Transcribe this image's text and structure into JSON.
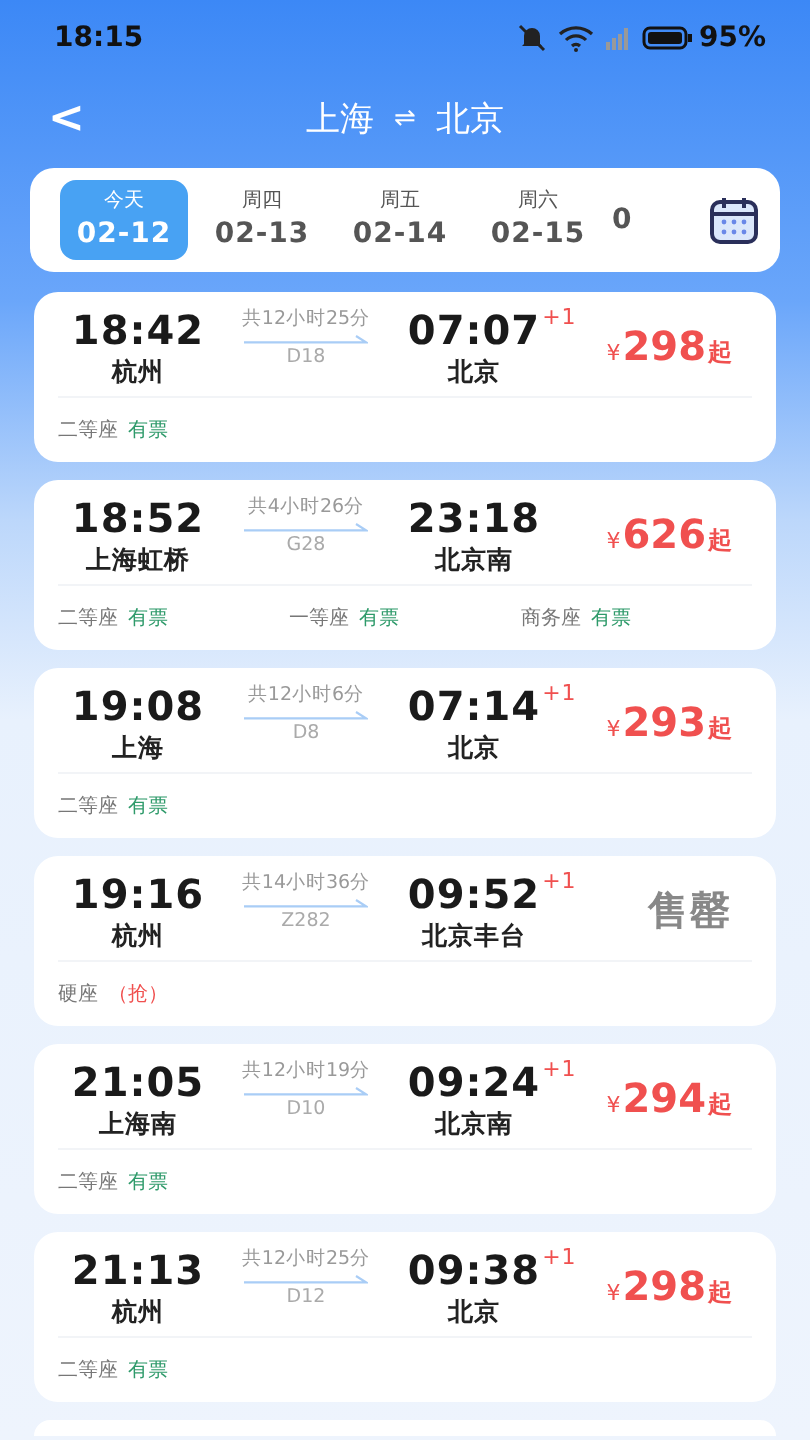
{
  "status_bar": {
    "time": "18:15",
    "battery": "95%"
  },
  "header": {
    "back": "<",
    "from": "上海",
    "swap": "⇌",
    "to": "北京"
  },
  "dates": [
    {
      "weekday": "今天",
      "date": "02-12",
      "selected": true
    },
    {
      "weekday": "周四",
      "date": "02-13",
      "selected": false
    },
    {
      "weekday": "周五",
      "date": "02-14",
      "selected": false
    },
    {
      "weekday": "周六",
      "date": "02-15",
      "selected": false
    },
    {
      "date": "0",
      "selected": false
    }
  ],
  "trains": [
    {
      "depart": "18:42",
      "from": "杭州",
      "duration": "共12小时25分",
      "code": "D18",
      "arrive": "07:07",
      "next_day": "+1",
      "to": "北京",
      "price": {
        "kind": "price",
        "currency": "¥",
        "amount": "298",
        "suffix": "起"
      },
      "seats": [
        {
          "class": "二等座",
          "status": "有票",
          "kind": "available"
        }
      ]
    },
    {
      "depart": "18:52",
      "from": "上海虹桥",
      "duration": "共4小时26分",
      "code": "G28",
      "arrive": "23:18",
      "to": "北京南",
      "price": {
        "kind": "price",
        "currency": "¥",
        "amount": "626",
        "suffix": "起"
      },
      "seats": [
        {
          "class": "二等座",
          "status": "有票",
          "kind": "available"
        },
        {
          "class": "一等座",
          "status": "有票",
          "kind": "available"
        },
        {
          "class": "商务座",
          "status": "有票",
          "kind": "available"
        }
      ]
    },
    {
      "depart": "19:08",
      "from": "上海",
      "duration": "共12小时6分",
      "code": "D8",
      "arrive": "07:14",
      "next_day": "+1",
      "to": "北京",
      "price": {
        "kind": "price",
        "currency": "¥",
        "amount": "293",
        "suffix": "起"
      },
      "seats": [
        {
          "class": "二等座",
          "status": "有票",
          "kind": "available"
        }
      ]
    },
    {
      "depart": "19:16",
      "from": "杭州",
      "duration": "共14小时36分",
      "code": "Z282",
      "arrive": "09:52",
      "next_day": "+1",
      "to": "北京丰台",
      "price": {
        "kind": "soldout",
        "text": "售罄"
      },
      "seats": [
        {
          "class": "硬座",
          "status": "（抢）",
          "kind": "grab"
        }
      ]
    },
    {
      "depart": "21:05",
      "from": "上海南",
      "duration": "共12小时19分",
      "code": "D10",
      "arrive": "09:24",
      "next_day": "+1",
      "to": "北京南",
      "price": {
        "kind": "price",
        "currency": "¥",
        "amount": "294",
        "suffix": "起"
      },
      "seats": [
        {
          "class": "二等座",
          "status": "有票",
          "kind": "available"
        }
      ]
    },
    {
      "depart": "21:13",
      "from": "杭州",
      "duration": "共12小时25分",
      "code": "D12",
      "arrive": "09:38",
      "next_day": "+1",
      "to": "北京",
      "price": {
        "kind": "price",
        "currency": "¥",
        "amount": "298",
        "suffix": "起"
      },
      "seats": [
        {
          "class": "二等座",
          "status": "有票",
          "kind": "available"
        }
      ]
    }
  ]
}
